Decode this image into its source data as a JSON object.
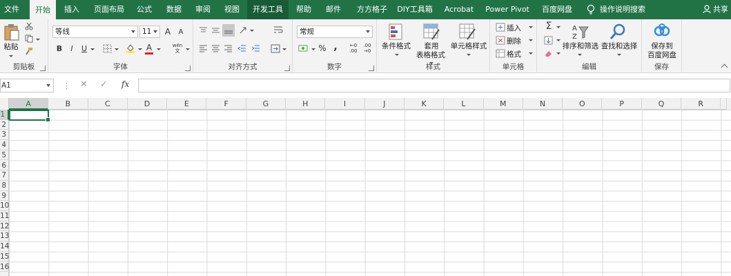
{
  "tabs": [
    {
      "id": "file",
      "label": "文件"
    },
    {
      "id": "home",
      "label": "开始"
    },
    {
      "id": "insert",
      "label": "插入"
    },
    {
      "id": "layout",
      "label": "页面布局"
    },
    {
      "id": "formulas",
      "label": "公式"
    },
    {
      "id": "data",
      "label": "数据"
    },
    {
      "id": "review",
      "label": "审阅"
    },
    {
      "id": "view",
      "label": "视图"
    },
    {
      "id": "developer",
      "label": "开发工具"
    },
    {
      "id": "help",
      "label": "帮助"
    },
    {
      "id": "mail",
      "label": "邮件"
    },
    {
      "id": "ffgz",
      "label": "方方格子"
    },
    {
      "id": "diy",
      "label": "DIY工具箱"
    },
    {
      "id": "acrobat",
      "label": "Acrobat"
    },
    {
      "id": "powerpivot",
      "label": "Power Pivot"
    },
    {
      "id": "baidu",
      "label": "百度网盘"
    },
    {
      "id": "tellme",
      "label": "操作说明搜索"
    }
  ],
  "active_tab": "开始",
  "hover_tab": "开发工具",
  "share_label": "共享",
  "ribbon": {
    "clipboard": {
      "label": "剪贴板",
      "paste": "粘贴"
    },
    "font": {
      "label": "字体",
      "font_name": "等线",
      "font_size": "11",
      "bold": "B",
      "italic": "I",
      "underline": "U",
      "grow": "A",
      "shrink": "A",
      "wen": "wén"
    },
    "alignment": {
      "label": "对齐方式"
    },
    "number": {
      "label": "数字",
      "format": "常规",
      "percent": "%",
      "comma": ","
    },
    "styles": {
      "label": "样式",
      "conditional": "条件格式",
      "table_format_1": "套用",
      "table_format_2": "表格格式",
      "cell_styles": "单元格样式"
    },
    "cells": {
      "label": "单元格",
      "insert": "插入",
      "delete": "删除",
      "format": "格式"
    },
    "editing": {
      "label": "编辑",
      "sort_filter": "排序和筛选",
      "find_select": "查找和选择"
    },
    "save": {
      "label": "保存",
      "save_to_1": "保存到",
      "save_to_2": "百度网盘"
    }
  },
  "formula_bar": {
    "name_box": "A1",
    "fx": "fx",
    "value": ""
  },
  "columns": [
    "A",
    "B",
    "C",
    "D",
    "E",
    "F",
    "G",
    "H",
    "I",
    "J",
    "K",
    "L",
    "M",
    "N",
    "O",
    "P",
    "Q",
    "R"
  ],
  "rows": [
    "1",
    "2",
    "3",
    "4",
    "5",
    "6",
    "7",
    "8",
    "9",
    "10",
    "11",
    "12",
    "13",
    "14",
    "15",
    "16"
  ],
  "colors": {
    "accent": "#217346",
    "ribbon_bg": "#f3f3f3"
  }
}
